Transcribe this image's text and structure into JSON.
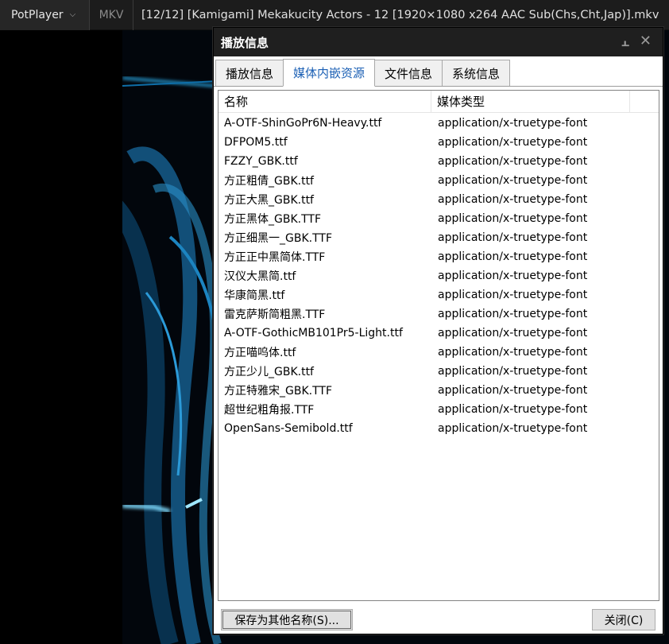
{
  "player": {
    "brand": "PotPlayer",
    "format": "MKV",
    "title": "[12/12] [Kamigami] Mekakucity Actors - 12 [1920×1080 x264 AAC Sub(Chs,Cht,Jap)].mkv"
  },
  "dialog": {
    "title": "播放信息",
    "tabs": [
      "播放信息",
      "媒体内嵌资源",
      "文件信息",
      "系统信息"
    ],
    "active_tab": 1,
    "columns": [
      "名称",
      "媒体类型"
    ],
    "rows": [
      [
        "A-OTF-ShinGoPr6N-Heavy.ttf",
        "application/x-truetype-font"
      ],
      [
        "DFPOM5.ttf",
        "application/x-truetype-font"
      ],
      [
        "FZZY_GBK.ttf",
        "application/x-truetype-font"
      ],
      [
        "方正粗倩_GBK.ttf",
        "application/x-truetype-font"
      ],
      [
        "方正大黑_GBK.ttf",
        "application/x-truetype-font"
      ],
      [
        "方正黑体_GBK.TTF",
        "application/x-truetype-font"
      ],
      [
        "方正细黑一_GBK.TTF",
        "application/x-truetype-font"
      ],
      [
        "方正正中黑简体.TTF",
        "application/x-truetype-font"
      ],
      [
        "汉仪大黑简.ttf",
        "application/x-truetype-font"
      ],
      [
        "华康简黑.ttf",
        "application/x-truetype-font"
      ],
      [
        "雷克萨斯简粗黑.TTF",
        "application/x-truetype-font"
      ],
      [
        "A-OTF-GothicMB101Pr5-Light.ttf",
        "application/x-truetype-font"
      ],
      [
        "方正喵呜体.ttf",
        "application/x-truetype-font"
      ],
      [
        "方正少儿_GBK.ttf",
        "application/x-truetype-font"
      ],
      [
        "方正特雅宋_GBK.TTF",
        "application/x-truetype-font"
      ],
      [
        "超世纪粗角报.TTF",
        "application/x-truetype-font"
      ],
      [
        "OpenSans-Semibold.ttf",
        "application/x-truetype-font"
      ]
    ],
    "save_label": "保存为其他名称(S)...",
    "close_label": "关闭(C)"
  },
  "icons": {
    "brand_menu": "chevron-down-icon",
    "pin": "pin-icon",
    "close": "close-icon"
  },
  "colors": {
    "accent": "#1a5fb4",
    "titlebar": "#1c1c1c",
    "video_glow": "#2aa8e8"
  }
}
